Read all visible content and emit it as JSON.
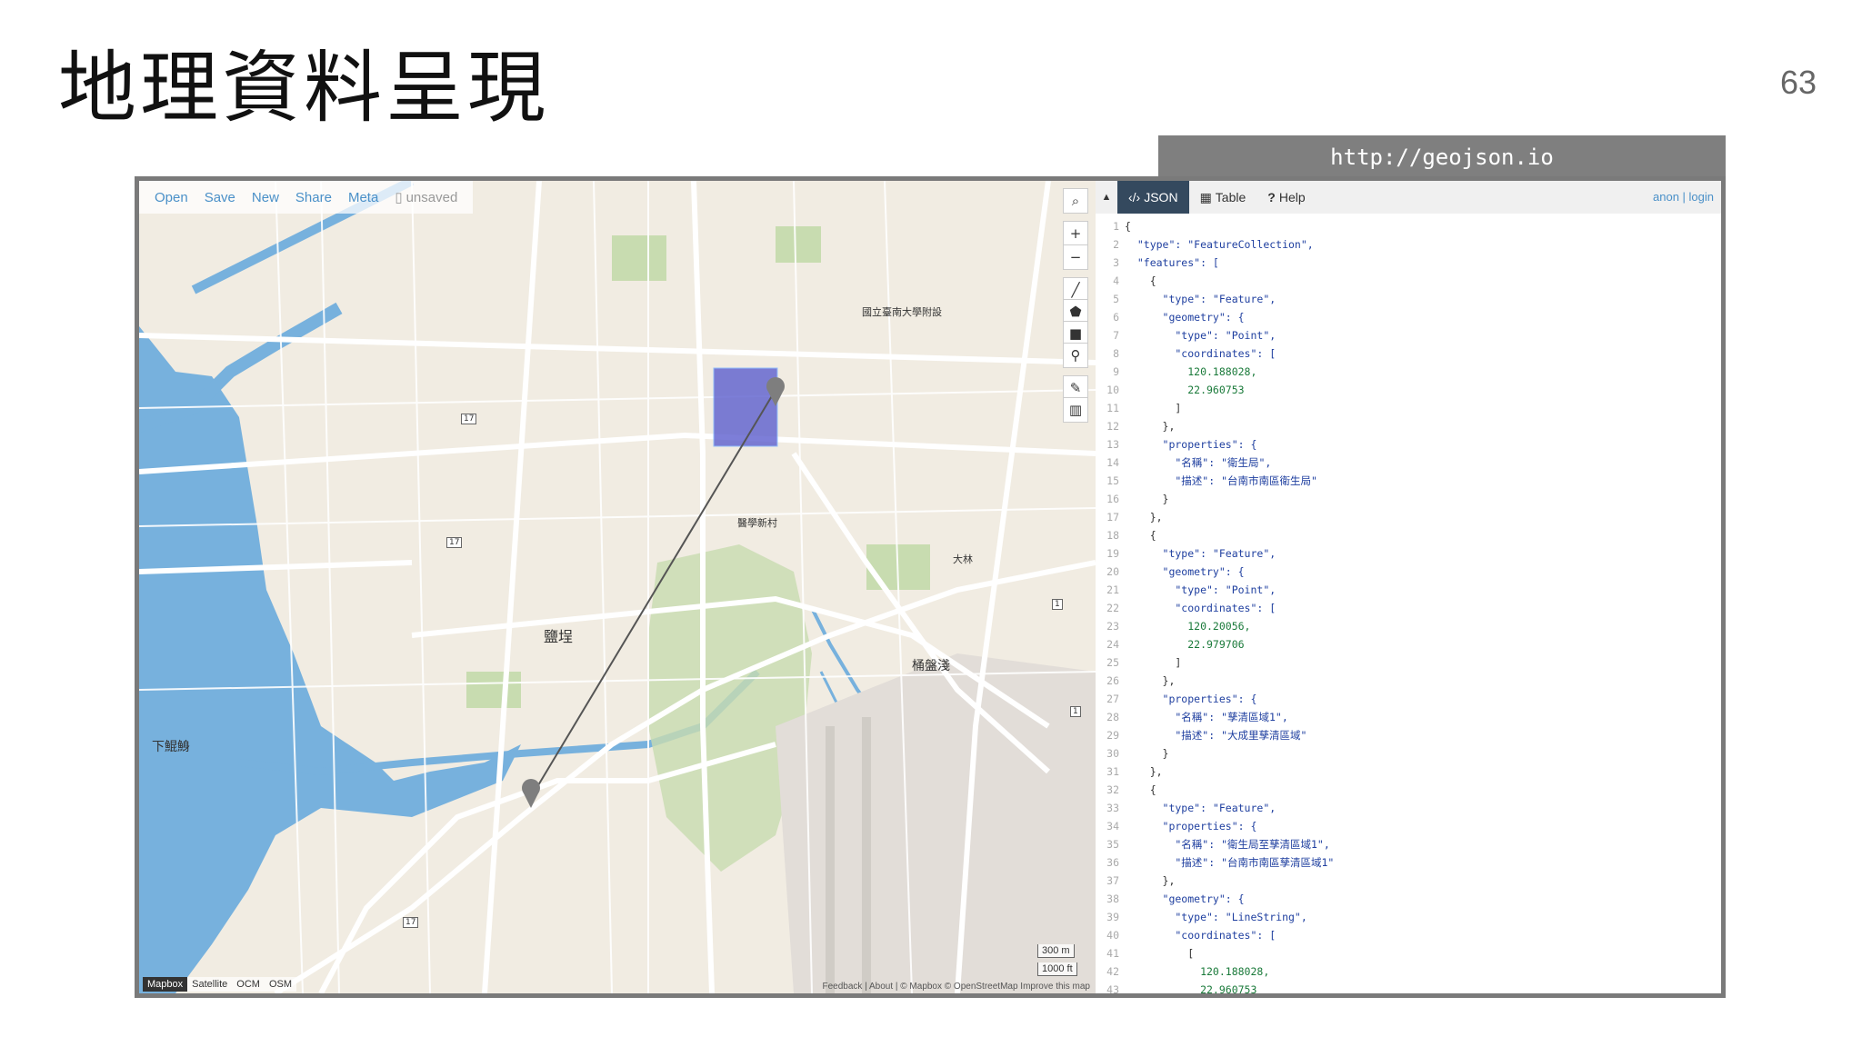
{
  "slide": {
    "title": "地理資料呈現",
    "page_number": "63",
    "url_label": "http://geojson.io"
  },
  "map": {
    "toolbar": [
      "Open",
      "Save",
      "New",
      "Share",
      "Meta"
    ],
    "unsaved": "unsaved",
    "zoom_in": "+",
    "zoom_out": "−",
    "scale": [
      "300 m",
      "1000 ft"
    ],
    "layers": [
      "Mapbox",
      "Satellite",
      "OCM",
      "OSM"
    ],
    "attribution": "Feedback | About | © Mapbox © OpenStreetMap Improve this map",
    "place_labels": [
      "鹽埕",
      "桶盤淺",
      "下鯤鯓",
      "醫學新村",
      "國立臺南大學附設",
      "大林"
    ],
    "route_shields": [
      "17",
      "17",
      "17",
      "1",
      "1",
      "17"
    ]
  },
  "panel": {
    "tabs": [
      "JSON",
      "Table",
      "Help"
    ],
    "active_tab": "JSON",
    "auth": "anon | login",
    "code_lines": [
      "{",
      "  \"type\": \"FeatureCollection\",",
      "  \"features\": [",
      "    {",
      "      \"type\": \"Feature\",",
      "      \"geometry\": {",
      "        \"type\": \"Point\",",
      "        \"coordinates\": [",
      "          120.188028,",
      "          22.960753",
      "        ]",
      "      },",
      "      \"properties\": {",
      "        \"名稱\": \"衛生局\",",
      "        \"描述\": \"台南市南區衛生局\"",
      "      }",
      "    },",
      "    {",
      "      \"type\": \"Feature\",",
      "      \"geometry\": {",
      "        \"type\": \"Point\",",
      "        \"coordinates\": [",
      "          120.20056,",
      "          22.979706",
      "        ]",
      "      },",
      "      \"properties\": {",
      "        \"名稱\": \"孳清區域1\",",
      "        \"描述\": \"大成里孳清區域\"",
      "      }",
      "    },",
      "    {",
      "      \"type\": \"Feature\",",
      "      \"properties\": {",
      "        \"名稱\": \"衛生局至孳清區域1\",",
      "        \"描述\": \"台南市南區孳清區域1\"",
      "      },",
      "      \"geometry\": {",
      "        \"type\": \"LineString\",",
      "        \"coordinates\": [",
      "          [",
      "            120.188028,",
      "            22.960753"
    ]
  }
}
